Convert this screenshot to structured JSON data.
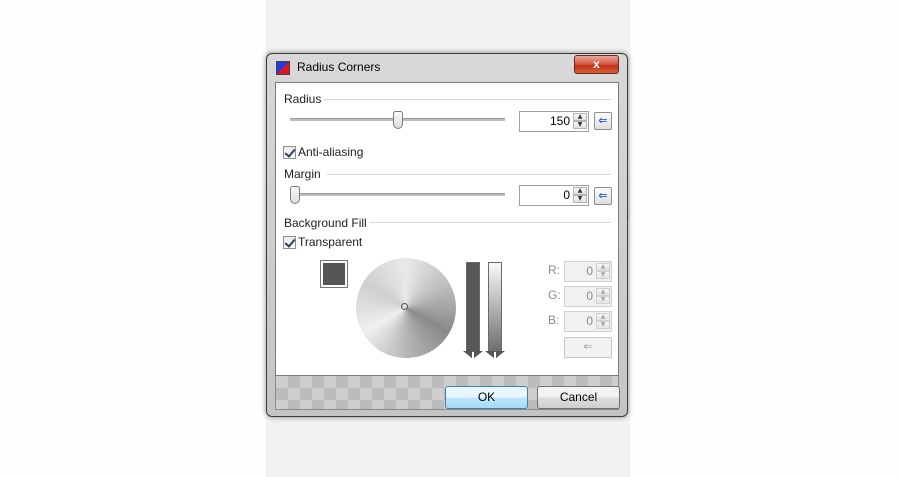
{
  "window": {
    "title": "Radius Corners",
    "close_glyph": "x"
  },
  "radius": {
    "label": "Radius",
    "slider_level": 0.5,
    "value": "150",
    "reset_glyph": "⇐"
  },
  "anti_aliasing": {
    "label": "Anti-aliasing",
    "checked": true
  },
  "margin": {
    "label": "Margin",
    "slider_level": 0.0,
    "value": "0",
    "reset_glyph": "⇐"
  },
  "background_fill": {
    "label": "Background Fill",
    "transparent_label": "Transparent",
    "swatch_color": "#555555",
    "r_label": "R:",
    "r_value": "0",
    "g_label": "G:",
    "g_value": "0",
    "b_label": "B:",
    "b_value": "0",
    "apply_glyph": "⇐"
  },
  "buttons": {
    "ok": "OK",
    "cancel": "Cancel"
  },
  "colors": {
    "close_button": "#c33018",
    "default_button_border": "#3c7fb1"
  }
}
